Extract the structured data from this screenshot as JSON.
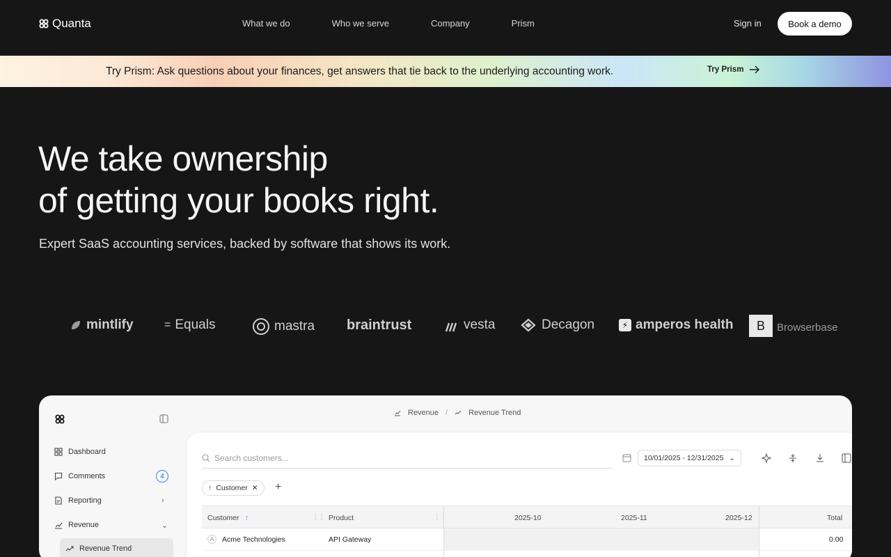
{
  "nav": {
    "logo_text": "Quanta",
    "links": [
      "What we do",
      "Who we serve",
      "Company",
      "Prism"
    ],
    "sign_in": "Sign in",
    "cta": "Book a demo"
  },
  "banner": {
    "text": "Try Prism: Ask questions about your finances, get answers that tie back to the underlying accounting work.",
    "cta": "Try Prism"
  },
  "hero": {
    "title_line1": "We take ownership",
    "title_line2": "of getting your books right.",
    "subtitle": "Expert SaaS accounting services, backed by software that shows its work."
  },
  "logos": [
    "mintlify",
    "Equals",
    "mastra",
    "braintrust",
    "vesta",
    "Decagon",
    "amperos health",
    "Browserbase"
  ],
  "app": {
    "sidebar": {
      "items": [
        {
          "label": "Dashboard",
          "icon": "grid-icon"
        },
        {
          "label": "Comments",
          "icon": "comment-icon",
          "badge": "4"
        },
        {
          "label": "Reporting",
          "icon": "document-icon"
        },
        {
          "label": "Revenue",
          "icon": "chart-icon"
        }
      ],
      "active_sub": "Revenue Trend"
    },
    "breadcrumb": [
      "Revenue",
      "Revenue Trend"
    ],
    "search_placeholder": "Search customers...",
    "date_range": "10/01/2025 - 12/31/2025",
    "filter_chip": "Customer",
    "columns": [
      "Customer",
      "Product",
      "2025-10",
      "2025-11",
      "2025-12",
      "Total"
    ],
    "rows": [
      {
        "avatar": "A",
        "customer": "Acme Technologies",
        "product": "API Gateway",
        "total": "0.00"
      }
    ]
  }
}
